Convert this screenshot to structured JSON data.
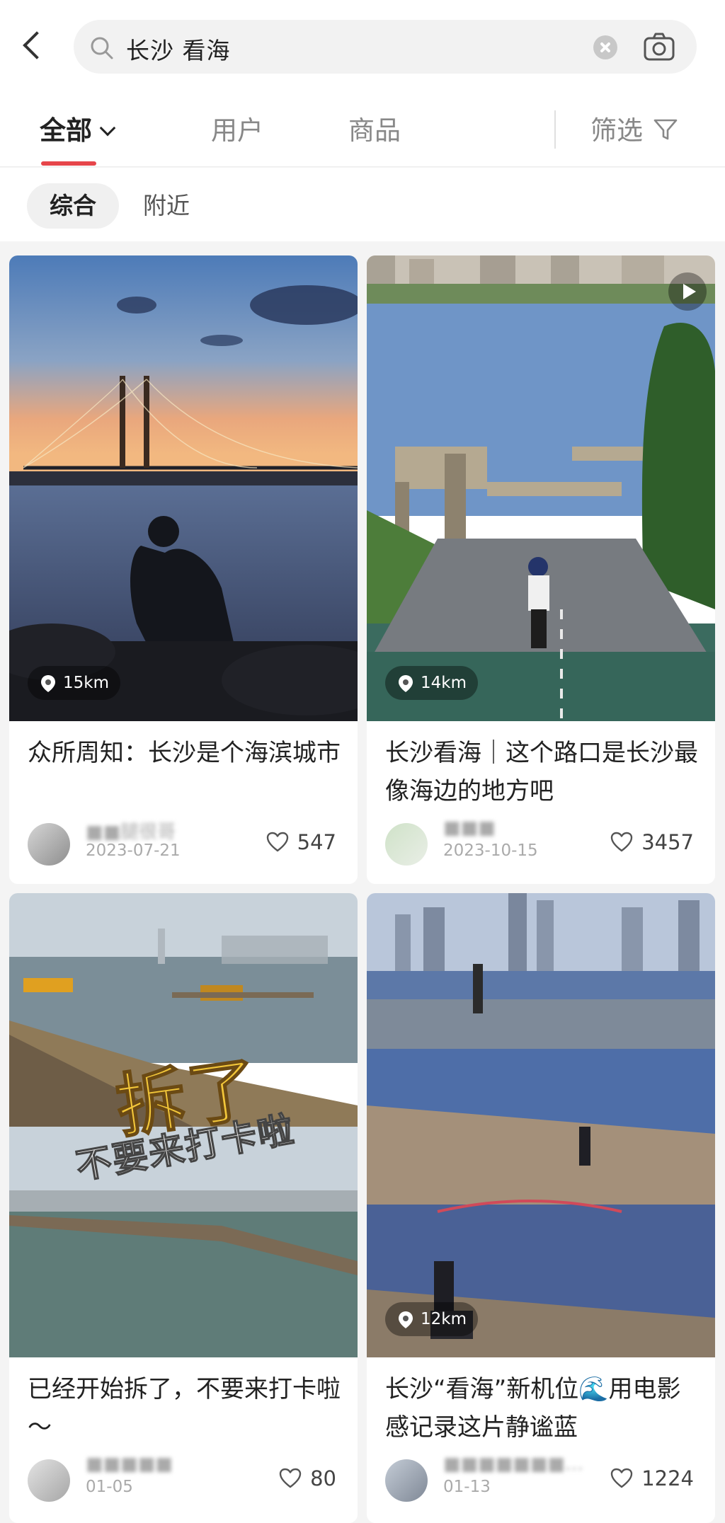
{
  "search": {
    "query": "长沙 看海"
  },
  "tabs": {
    "all": "全部",
    "users": "用户",
    "goods": "商品",
    "filter": "筛选"
  },
  "subtabs": {
    "comprehensive": "综合",
    "nearby": "附近"
  },
  "colors": {
    "accent": "#e6454a",
    "background": "#f4f4f4"
  },
  "cards": [
    {
      "distance": "15km",
      "title": "众所周知：长沙是个海滨城市",
      "author": "■■腿很哥",
      "date": "2023-07-21",
      "likes": "547"
    },
    {
      "distance": "14km",
      "title": "长沙看海｜这个路口是长沙最像海边的地方吧",
      "author": "■■■",
      "date": "2023-10-15",
      "likes": "3457",
      "is_video": true
    },
    {
      "distance": "",
      "title": "已经开始拆了，不要来打卡啦～",
      "overlay_text_1": "拆了",
      "overlay_text_2": "不要来打卡啦",
      "author": "■■■■■",
      "date": "01-05",
      "likes": "80"
    },
    {
      "distance": "12km",
      "title": "长沙“看海”新机位🌊用电影感记录这片静谧蓝",
      "author": "■■■■■■■…",
      "date": "01-13",
      "likes": "1224"
    }
  ]
}
